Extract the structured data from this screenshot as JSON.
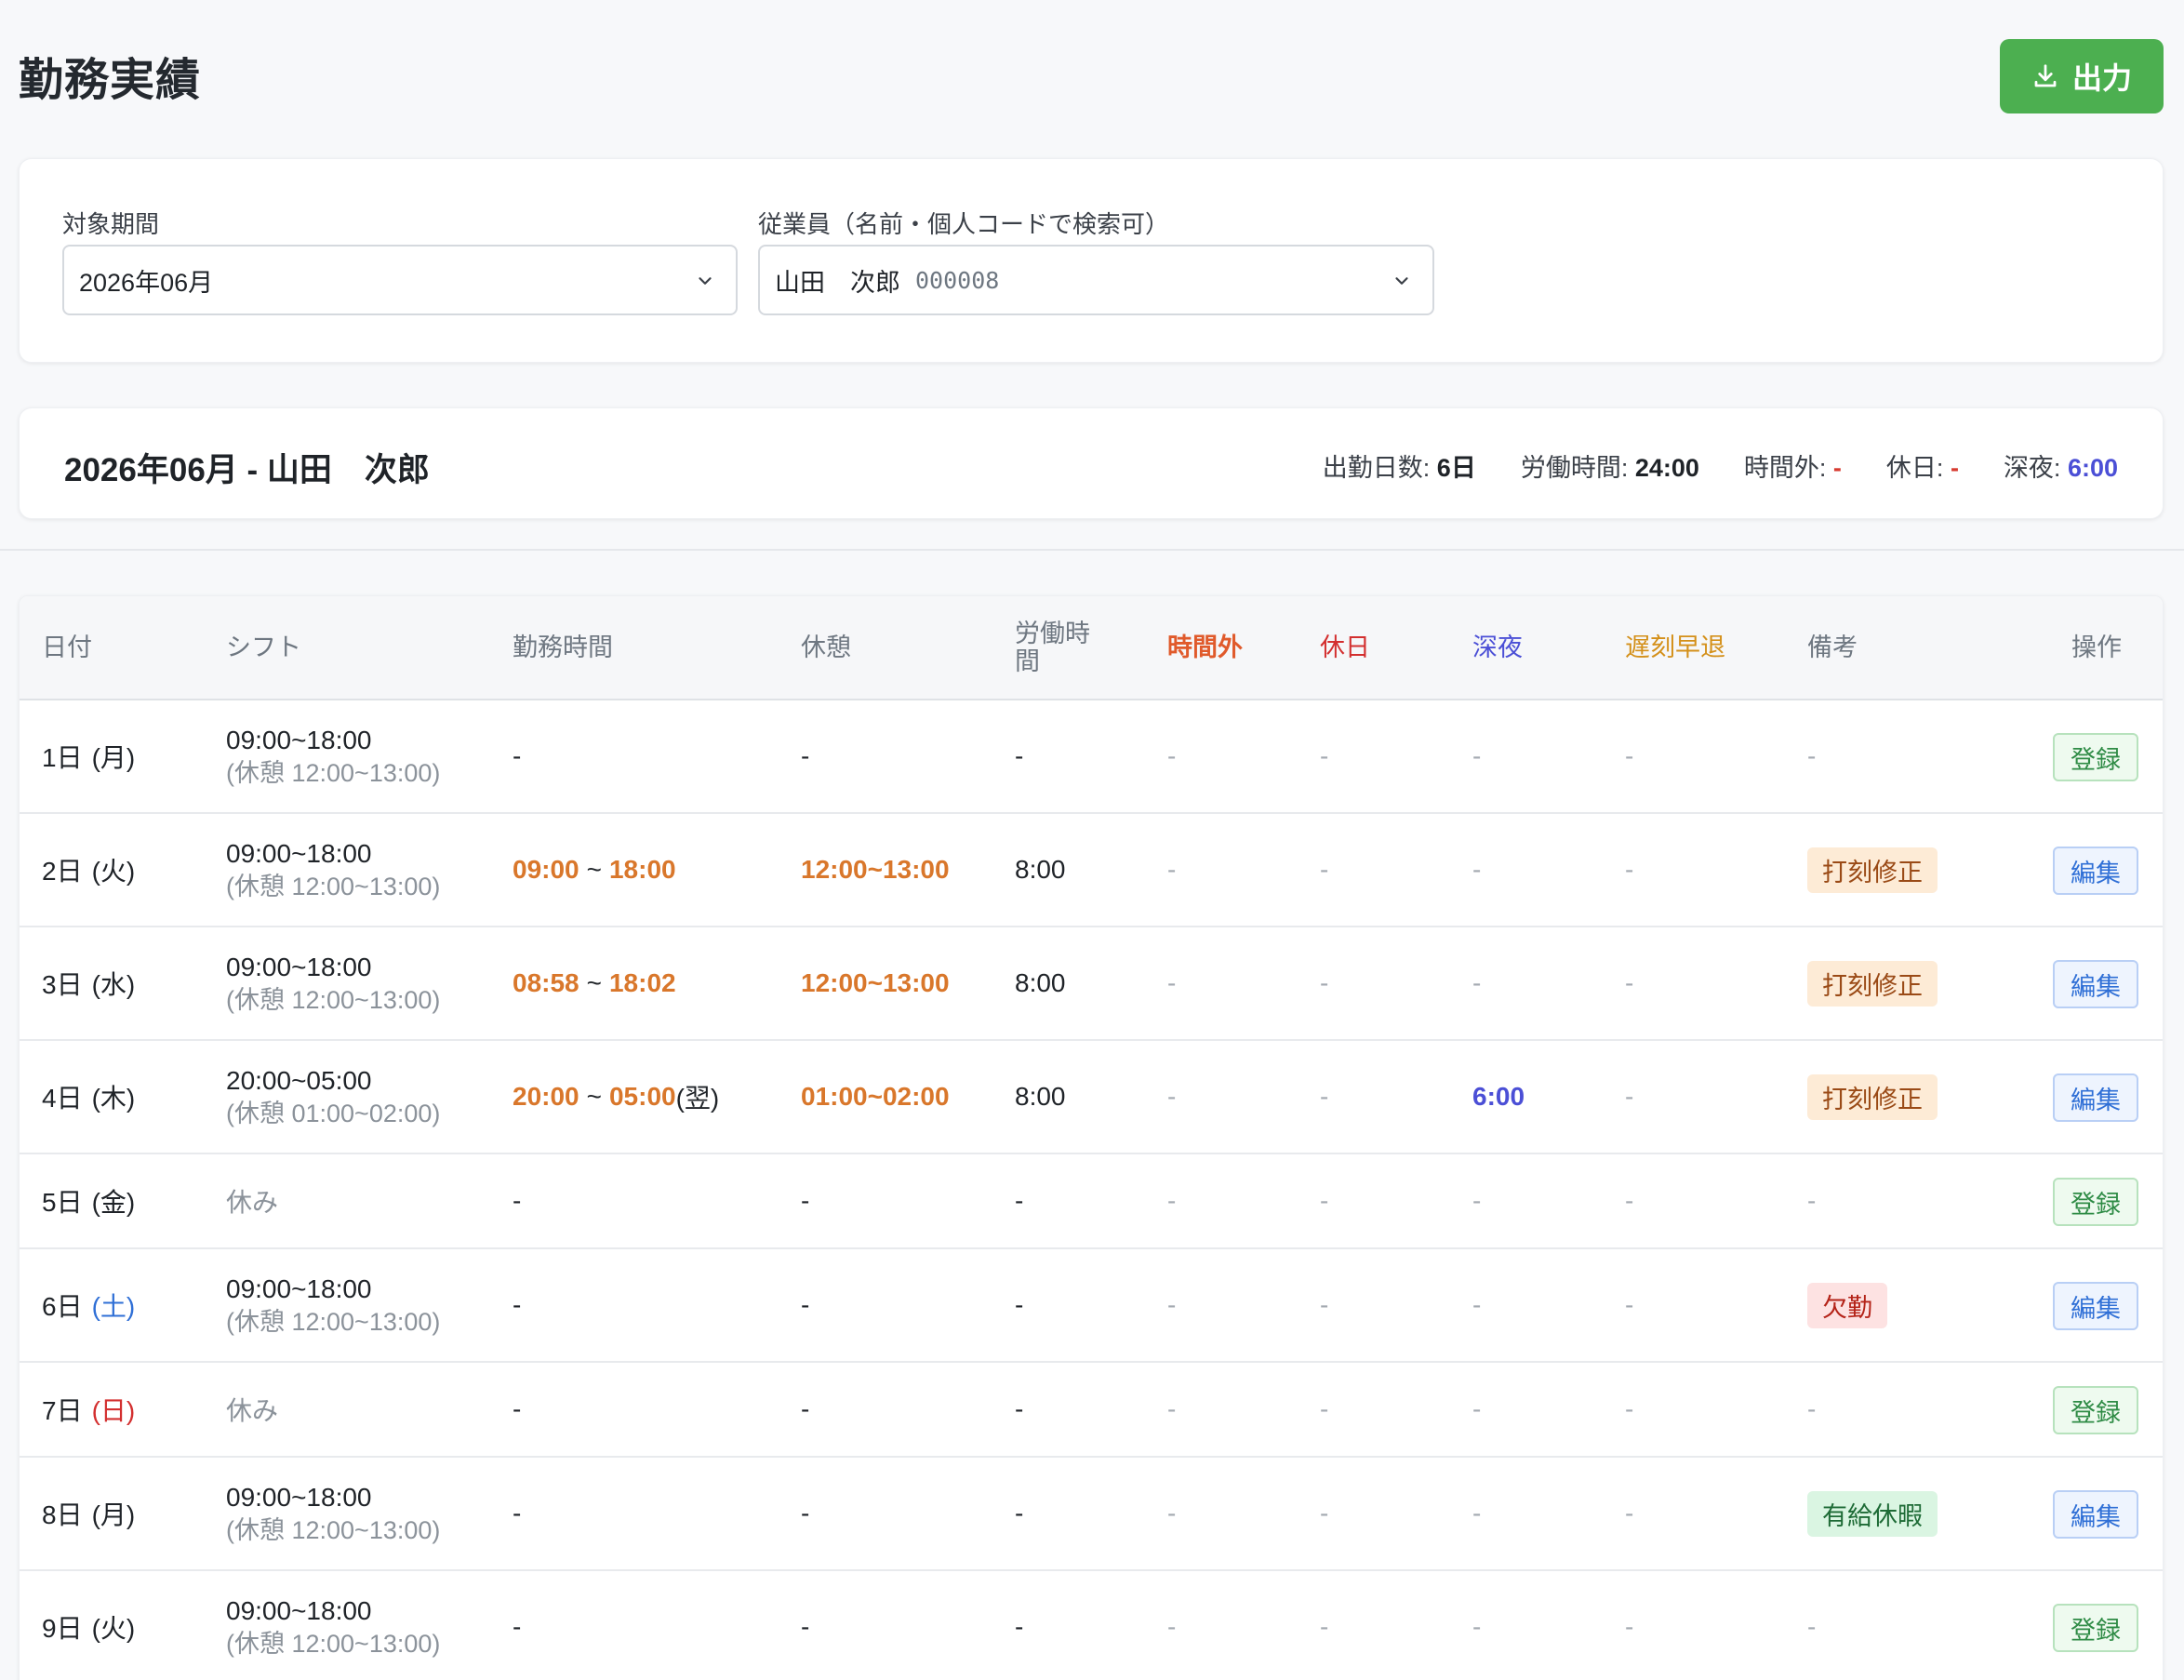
{
  "page": {
    "title": "勤務実績",
    "export_label": "出力"
  },
  "filters": {
    "period_label": "対象期間",
    "period_value": "2026年06月",
    "employee_label": "従業員（名前・個人コードで検索可）",
    "employee_name": "山田　次郎",
    "employee_code": "000008"
  },
  "summary": {
    "title": "2026年06月 - 山田　次郎",
    "stats": [
      {
        "label": "出勤日数: ",
        "value": "6日",
        "style": "bold"
      },
      {
        "label": "労働時間: ",
        "value": "24:00",
        "style": "bold"
      },
      {
        "label": "時間外: ",
        "value": "-",
        "style": "red"
      },
      {
        "label": "休日: ",
        "value": "-",
        "style": "red"
      },
      {
        "label": "深夜: ",
        "value": "6:00",
        "style": "purple"
      }
    ]
  },
  "table": {
    "headers": {
      "date": "日付",
      "shift": "シフト",
      "work_time": "勤務時間",
      "break": "休憩",
      "labor_line1": "労働時",
      "labor_line2": "間",
      "overtime": "時間外",
      "holiday": "休日",
      "night": "深夜",
      "late_early": "遅刻早退",
      "notes": "備考",
      "action": "操作"
    },
    "rows": [
      {
        "day": "1日",
        "dow": "(月)",
        "dow_type": "weekday",
        "shift_main": "09:00~18:00",
        "shift_sub": "(休憩 12:00~13:00)",
        "work_in": "",
        "work_out": "",
        "work_plain": "-",
        "work_suffix": "",
        "break": "-",
        "break_hl": false,
        "labor": "-",
        "overtime": "-",
        "holiday": "-",
        "night": "-",
        "late": "-",
        "note": "-",
        "note_type": "none",
        "action": "登録",
        "action_type": "reg"
      },
      {
        "day": "2日",
        "dow": "(火)",
        "dow_type": "weekday",
        "shift_main": "09:00~18:00",
        "shift_sub": "(休憩 12:00~13:00)",
        "work_in": "09:00",
        "work_out": "18:00",
        "work_plain": "",
        "work_suffix": "",
        "break": "12:00~13:00",
        "break_hl": true,
        "labor": "8:00",
        "overtime": "-",
        "holiday": "-",
        "night": "-",
        "late": "-",
        "note": "打刻修正",
        "note_type": "stamp",
        "action": "編集",
        "action_type": "edit"
      },
      {
        "day": "3日",
        "dow": "(水)",
        "dow_type": "weekday",
        "shift_main": "09:00~18:00",
        "shift_sub": "(休憩 12:00~13:00)",
        "work_in": "08:58",
        "work_out": "18:02",
        "work_plain": "",
        "work_suffix": "",
        "break": "12:00~13:00",
        "break_hl": true,
        "labor": "8:00",
        "overtime": "-",
        "holiday": "-",
        "night": "-",
        "late": "-",
        "note": "打刻修正",
        "note_type": "stamp",
        "action": "編集",
        "action_type": "edit"
      },
      {
        "day": "4日",
        "dow": "(木)",
        "dow_type": "weekday",
        "shift_main": "20:00~05:00",
        "shift_sub": "(休憩 01:00~02:00)",
        "work_in": "20:00",
        "work_out": "05:00",
        "work_plain": "",
        "work_suffix": " (翌)",
        "break": "01:00~02:00",
        "break_hl": true,
        "labor": "8:00",
        "overtime": "-",
        "holiday": "-",
        "night": "6:00",
        "late": "-",
        "note": "打刻修正",
        "note_type": "stamp",
        "action": "編集",
        "action_type": "edit"
      },
      {
        "day": "5日",
        "dow": "(金)",
        "dow_type": "weekday",
        "shift_main": "休み",
        "shift_sub": "",
        "work_in": "",
        "work_out": "",
        "work_plain": "-",
        "work_suffix": "",
        "break": "-",
        "break_hl": false,
        "labor": "-",
        "overtime": "-",
        "holiday": "-",
        "night": "-",
        "late": "-",
        "note": "-",
        "note_type": "none",
        "action": "登録",
        "action_type": "reg"
      },
      {
        "day": "6日",
        "dow": "(土)",
        "dow_type": "sat",
        "shift_main": "09:00~18:00",
        "shift_sub": "(休憩 12:00~13:00)",
        "work_in": "",
        "work_out": "",
        "work_plain": "-",
        "work_suffix": "",
        "break": "-",
        "break_hl": false,
        "labor": "-",
        "overtime": "-",
        "holiday": "-",
        "night": "-",
        "late": "-",
        "note": "欠勤",
        "note_type": "absent",
        "action": "編集",
        "action_type": "edit"
      },
      {
        "day": "7日",
        "dow": "(日)",
        "dow_type": "sun",
        "shift_main": "休み",
        "shift_sub": "",
        "work_in": "",
        "work_out": "",
        "work_plain": "-",
        "work_suffix": "",
        "break": "-",
        "break_hl": false,
        "labor": "-",
        "overtime": "-",
        "holiday": "-",
        "night": "-",
        "late": "-",
        "note": "-",
        "note_type": "none",
        "action": "登録",
        "action_type": "reg"
      },
      {
        "day": "8日",
        "dow": "(月)",
        "dow_type": "weekday",
        "shift_main": "09:00~18:00",
        "shift_sub": "(休憩 12:00~13:00)",
        "work_in": "",
        "work_out": "",
        "work_plain": "-",
        "work_suffix": "",
        "break": "-",
        "break_hl": false,
        "labor": "-",
        "overtime": "-",
        "holiday": "-",
        "night": "-",
        "late": "-",
        "note": "有給休暇",
        "note_type": "leave",
        "action": "編集",
        "action_type": "edit"
      },
      {
        "day": "9日",
        "dow": "(火)",
        "dow_type": "weekday",
        "shift_main": "09:00~18:00",
        "shift_sub": "(休憩 12:00~13:00)",
        "work_in": "",
        "work_out": "",
        "work_plain": "-",
        "work_suffix": "",
        "break": "-",
        "break_hl": false,
        "labor": "-",
        "overtime": "-",
        "holiday": "-",
        "night": "-",
        "late": "-",
        "note": "-",
        "note_type": "none",
        "action": "登録",
        "action_type": "reg"
      }
    ]
  },
  "icons": {
    "export": "download-icon",
    "select": "chevron-down-icon"
  },
  "colors": {
    "accent_green": "#4caf50",
    "overtime": "#e05a2b",
    "holiday": "#d32f2f",
    "night": "#4b4fd6",
    "late": "#d4901a",
    "highlight_orange": "#d9772b"
  }
}
